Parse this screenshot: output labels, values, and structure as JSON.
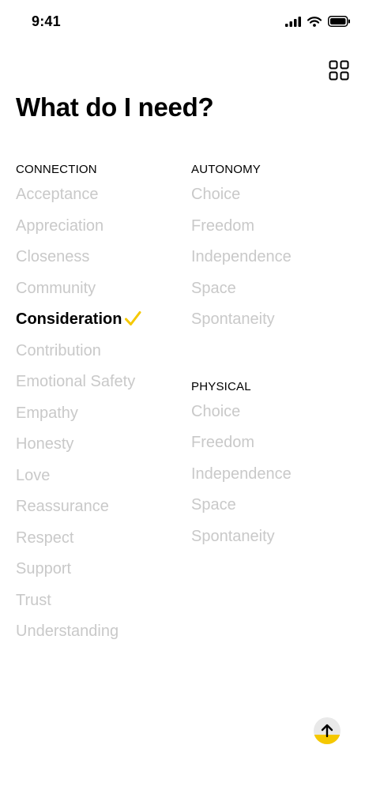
{
  "status": {
    "time": "9:41"
  },
  "header": {
    "title": "What do I need?",
    "menu_icon": "grid-icon"
  },
  "accent_color": "#F5C800",
  "sections": {
    "connection": {
      "label": "CONNECTION",
      "items": [
        "Acceptance",
        "Appreciation",
        "Closeness",
        "Community",
        "Consideration",
        "Contribution",
        "Emotional Safety",
        "Empathy",
        "Honesty",
        "Love",
        "Reassurance",
        "Respect",
        "Support",
        "Trust",
        "Understanding"
      ],
      "selected": "Consideration"
    },
    "autonomy": {
      "label": "AUTONOMY",
      "items": [
        "Choice",
        "Freedom",
        "Independence",
        "Space",
        "Spontaneity"
      ]
    },
    "physical": {
      "label": "PHYSICAL",
      "items": [
        "Choice",
        "Freedom",
        "Independence",
        "Space",
        "Spontaneity"
      ]
    }
  },
  "scroll_top_icon": "arrow-up-icon"
}
